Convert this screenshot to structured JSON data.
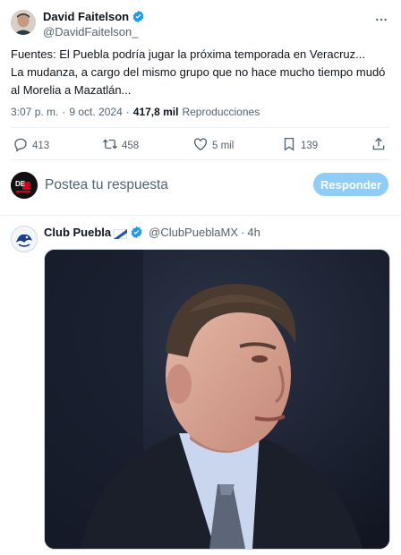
{
  "tweet": {
    "author_name": "David Faitelson",
    "author_handle": "@DavidFaitelson_",
    "text": "Fuentes: El Puebla podría jugar la próxima temporada en Veracruz...\nLa mudanza, a cargo del mismo grupo que no hace mucho tiempo mudó al Morelia a Mazatlán...",
    "time": "3:07 p. m.",
    "separator": "·",
    "date": "9 oct. 2024",
    "views_count": "417,8 mil",
    "views_label": "Reproducciones",
    "actions": {
      "replies": "413",
      "retweets": "458",
      "likes": "5 mil",
      "bookmarks": "139"
    }
  },
  "reply_box": {
    "avatar_text": "DE",
    "placeholder": "Postea tu respuesta",
    "button_label": "Responder"
  },
  "reply_tweet": {
    "author_name": "Club Puebla",
    "author_handle": "@ClubPueblaMX",
    "separator": "·",
    "age": "4h"
  },
  "colors": {
    "verified": "#1d9bf0",
    "button_disabled": "#8ecdf8",
    "secondary_text": "#536471",
    "divider": "#eff3f4"
  },
  "icons": [
    "verified-badge-icon",
    "reply-icon",
    "retweet-icon",
    "like-icon",
    "bookmark-icon",
    "share-icon",
    "flag-icon"
  ]
}
